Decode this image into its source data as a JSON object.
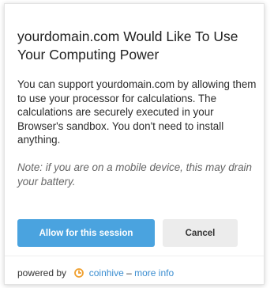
{
  "dialog": {
    "title": "yourdomain.com Would Like To Use Your Computing Power",
    "body": "You can support yourdomain.com by allowing them to use your processor for calculations. The calculations are securely executed in your Browser's sandbox. You don't need to install anything.",
    "note": "Note: if you are on a mobile device, this may drain your battery."
  },
  "buttons": {
    "allow_label": "Allow for this session",
    "cancel_label": "Cancel"
  },
  "footer": {
    "powered_by": "powered by",
    "brand": "coinhive",
    "separator": " – ",
    "more_info": "more info"
  },
  "colors": {
    "accent": "#4aa3df",
    "cancel_bg": "#ececec",
    "link": "#3a8dd0",
    "logo": "#f0a030"
  },
  "icons": {
    "brand_logo": "coinhive-logo-icon"
  }
}
